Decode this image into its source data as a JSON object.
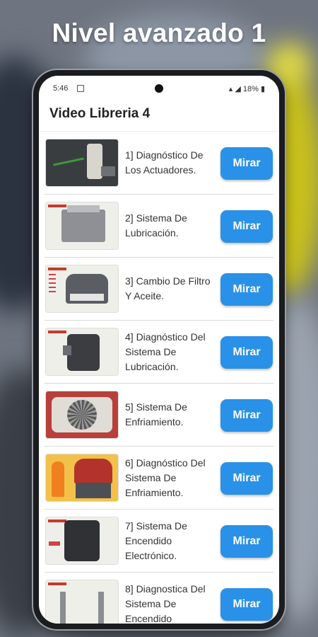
{
  "headline": "Nivel avanzado 1",
  "status": {
    "time": "5:46",
    "battery": "18%"
  },
  "app": {
    "title": "Video Libreria 4"
  },
  "items": [
    {
      "label": "1] Diagnóstico De Los Actuadores.",
      "button": "Mirar"
    },
    {
      "label": "2] Sistema De Lubricación.",
      "button": "Mirar"
    },
    {
      "label": "3] Cambio De Filtro Y Aceite.",
      "button": "Mirar"
    },
    {
      "label": "4] Diagnóstico Del Sistema De Lubricación.",
      "button": "Mirar"
    },
    {
      "label": "5] Sistema De Enfriamiento.",
      "button": "Mirar"
    },
    {
      "label": "6] Diagnóstico Del Sistema De Enfriamiento.",
      "button": "Mirar"
    },
    {
      "label": "7] Sistema De Encendido Electrónico.",
      "button": "Mirar"
    },
    {
      "label": "8] Diagnostica Del Sistema De Encendido",
      "button": "Mirar"
    }
  ],
  "colors": {
    "button": "#2a91e8",
    "accent_yellow": "#c9c11a"
  }
}
